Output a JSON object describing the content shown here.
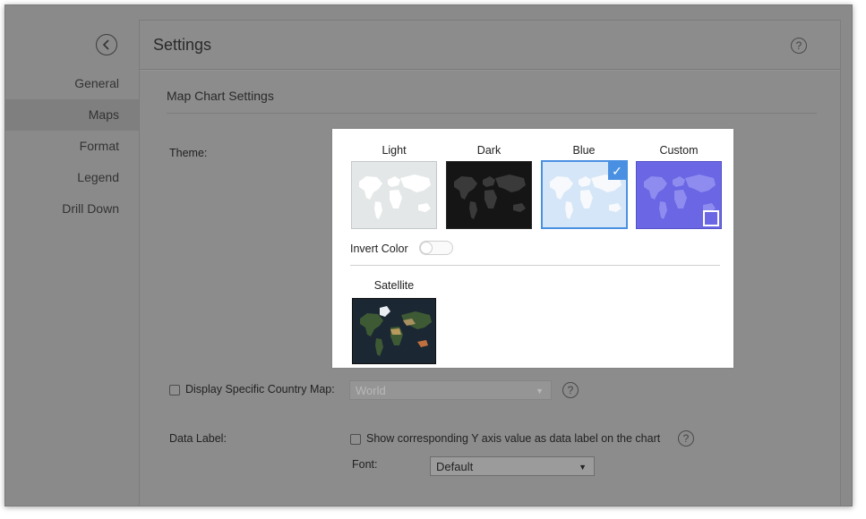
{
  "sidebar": {
    "items": [
      {
        "label": "General",
        "active": false
      },
      {
        "label": "Maps",
        "active": true
      },
      {
        "label": "Format",
        "active": false
      },
      {
        "label": "Legend",
        "active": false
      },
      {
        "label": "Drill Down",
        "active": false
      }
    ]
  },
  "header": {
    "title": "Settings",
    "help": "?"
  },
  "section": {
    "title": "Map Chart Settings"
  },
  "theme": {
    "label": "Theme:",
    "options": [
      {
        "label": "Light",
        "selected": false,
        "bg": "#e4e7e8",
        "land": "#ffffff"
      },
      {
        "label": "Dark",
        "selected": true,
        "bg": "#151515",
        "land": "#3a3a3a"
      },
      {
        "label": "Blue",
        "selected": true,
        "bg": "#d4e6f7",
        "land": "#f7f9fc"
      },
      {
        "label": "Custom",
        "selected": false,
        "bg": "#6a66e4",
        "land": "#8f8cf0"
      }
    ],
    "check_glyph": "✓",
    "invert_color": {
      "label": "Invert Color",
      "on": false
    },
    "satellite": {
      "label": "Satellite"
    },
    "accent_color": "#4a90e2"
  },
  "country_map": {
    "label": "Display Specific Country Map:",
    "checked": false,
    "select_value": "World",
    "help": "?"
  },
  "data_label": {
    "label": "Data Label:",
    "checkbox_label": "Show corresponding Y axis value as data label on the chart",
    "checked": false,
    "help": "?",
    "font_label": "Font:",
    "font_value": "Default"
  }
}
